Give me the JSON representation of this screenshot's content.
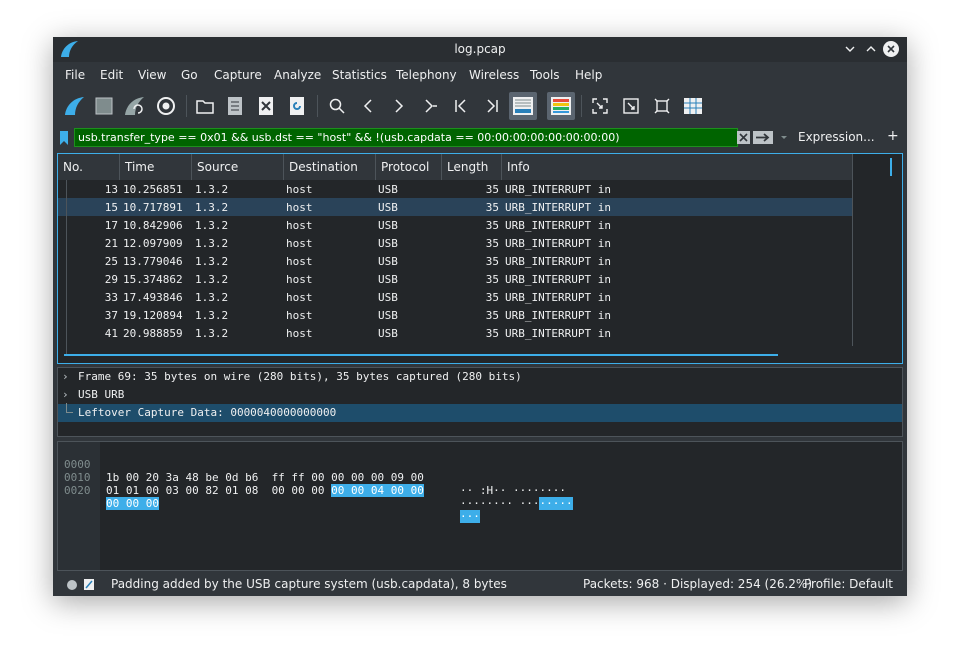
{
  "window": {
    "title": "log.pcap"
  },
  "menu": [
    "File",
    "Edit",
    "View",
    "Go",
    "Capture",
    "Analyze",
    "Statistics",
    "Telephony",
    "Wireless",
    "Tools",
    "Help"
  ],
  "toolbar": {
    "icons": [
      "start-capture-icon",
      "stop-capture-icon",
      "restart-capture-icon",
      "capture-options-icon",
      "open-file-icon",
      "save-file-icon",
      "close-file-icon",
      "reload-file-icon",
      "find-packet-icon",
      "go-back-icon",
      "go-forward-icon",
      "go-to-packet-icon",
      "go-first-icon",
      "go-last-icon",
      "auto-scroll-icon",
      "colorize-icon",
      "zoom-in-icon",
      "zoom-out-icon",
      "normal-size-icon",
      "resize-columns-icon"
    ]
  },
  "filter": {
    "value": "usb.transfer_type == 0x01 && usb.dst == \"host\" && !(usb.capdata == 00:00:00:00:00:00:00:00)",
    "expression_label": "Expression...",
    "plus_label": "+",
    "bg_color": "#006400"
  },
  "packet_list": {
    "columns": [
      "No.",
      "Time",
      "Source",
      "Destination",
      "Protocol",
      "Length",
      "Info"
    ],
    "rows": [
      {
        "no": "13",
        "time": "10.256851",
        "source": "1.3.2",
        "destination": "host",
        "protocol": "USB",
        "length": "35",
        "info": "URB_INTERRUPT in"
      },
      {
        "no": "15",
        "time": "10.717891",
        "source": "1.3.2",
        "destination": "host",
        "protocol": "USB",
        "length": "35",
        "info": "URB_INTERRUPT in"
      },
      {
        "no": "17",
        "time": "10.842906",
        "source": "1.3.2",
        "destination": "host",
        "protocol": "USB",
        "length": "35",
        "info": "URB_INTERRUPT in"
      },
      {
        "no": "21",
        "time": "12.097909",
        "source": "1.3.2",
        "destination": "host",
        "protocol": "USB",
        "length": "35",
        "info": "URB_INTERRUPT in"
      },
      {
        "no": "25",
        "time": "13.779046",
        "source": "1.3.2",
        "destination": "host",
        "protocol": "USB",
        "length": "35",
        "info": "URB_INTERRUPT in"
      },
      {
        "no": "29",
        "time": "15.374862",
        "source": "1.3.2",
        "destination": "host",
        "protocol": "USB",
        "length": "35",
        "info": "URB_INTERRUPT in"
      },
      {
        "no": "33",
        "time": "17.493846",
        "source": "1.3.2",
        "destination": "host",
        "protocol": "USB",
        "length": "35",
        "info": "URB_INTERRUPT in"
      },
      {
        "no": "37",
        "time": "19.120894",
        "source": "1.3.2",
        "destination": "host",
        "protocol": "USB",
        "length": "35",
        "info": "URB_INTERRUPT in"
      },
      {
        "no": "41",
        "time": "20.988859",
        "source": "1.3.2",
        "destination": "host",
        "protocol": "USB",
        "length": "35",
        "info": "URB_INTERRUPT in"
      }
    ]
  },
  "details": {
    "rows": [
      {
        "expander": "›",
        "text": "Frame 69: 35 bytes on wire (280 bits), 35 bytes captured (280 bits)"
      },
      {
        "expander": "›",
        "text": "USB URB"
      },
      {
        "expander": "",
        "text": "Leftover Capture Data: 0000040000000000"
      }
    ]
  },
  "bytes": {
    "rows": [
      {
        "offset": "0000",
        "hex_plain": "1b 00 20 3a 48 be 0d b6  ff ff 00 00 00 00 09 00",
        "hex_hl": "",
        "ascii_plain": "·· :H·· ········",
        "ascii_hl": ""
      },
      {
        "offset": "0010",
        "hex_plain": "01 01 00 03 00 82 01 08  00 00 00 ",
        "hex_hl": "00 00 04 00 00",
        "ascii_plain": "········ ···",
        "ascii_hl": "·····"
      },
      {
        "offset": "0020",
        "hex_plain": "",
        "hex_hl": "00 00 00",
        "ascii_plain": "",
        "ascii_hl": "···"
      }
    ]
  },
  "status": {
    "text": "Padding added by the USB capture system (usb.capdata), 8 bytes",
    "packets": "Packets: 968 · Displayed: 254 (26.2%)",
    "profile": "Profile: Default"
  }
}
